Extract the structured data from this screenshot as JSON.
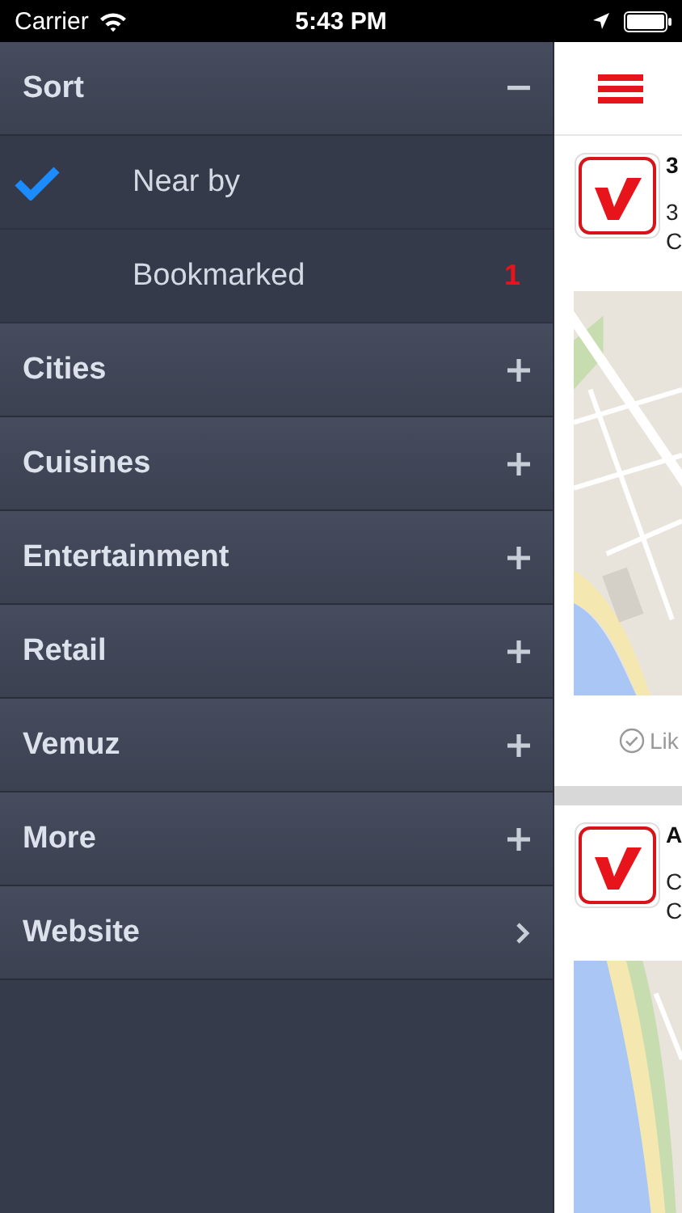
{
  "status_bar": {
    "carrier": "Carrier",
    "time": "5:43 PM"
  },
  "menu": [
    {
      "title": "Sort",
      "kind": "group",
      "expanded": true,
      "items": [
        {
          "label": "Near by",
          "selected": true
        },
        {
          "label": "Bookmarked",
          "selected": false,
          "count": "1"
        }
      ]
    },
    {
      "title": "Cities",
      "kind": "group",
      "expanded": false
    },
    {
      "title": "Cuisines",
      "kind": "group",
      "expanded": false
    },
    {
      "title": "Entertainment",
      "kind": "group",
      "expanded": false
    },
    {
      "title": "Retail",
      "kind": "group",
      "expanded": false
    },
    {
      "title": "Vemuz",
      "kind": "group",
      "expanded": false
    },
    {
      "title": "More",
      "kind": "group",
      "expanded": false
    },
    {
      "title": "Website",
      "kind": "link"
    }
  ],
  "cards": [
    {
      "title": "3",
      "lines": [
        "3",
        "C"
      ],
      "like": "Lik"
    },
    {
      "title": "A",
      "lines": [
        "C",
        "C"
      ]
    }
  ]
}
